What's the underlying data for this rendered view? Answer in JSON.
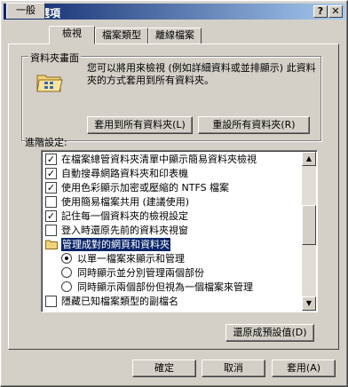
{
  "window": {
    "title": "資料夾選項"
  },
  "title_buttons": {
    "help": "?",
    "close": "✕"
  },
  "tabs": [
    {
      "label": "一般"
    },
    {
      "label": "檢視"
    },
    {
      "label": "檔案類型"
    },
    {
      "label": "離線檔案"
    }
  ],
  "folder_view": {
    "group_label": "資料夾畫面",
    "description": "您可以將用來檢視 (例如詳細資料或並排顯示) 此資料夾的方式套用到所有資料夾。",
    "apply_all_button": "套用到所有資料夾(L)",
    "reset_all_button": "重設所有資料夾(R)"
  },
  "advanced": {
    "label": "進階設定:",
    "items": [
      {
        "kind": "checkbox",
        "checked": true,
        "label": "在檔案總管資料夾清單中顯示簡易資料夾檢視"
      },
      {
        "kind": "checkbox",
        "checked": true,
        "label": "自動搜尋網路資料夾和印表機"
      },
      {
        "kind": "checkbox",
        "checked": true,
        "label": "使用色彩顯示加密或壓縮的 NTFS 檔案"
      },
      {
        "kind": "checkbox",
        "checked": false,
        "label": "使用簡易檔案共用 (建議使用)"
      },
      {
        "kind": "checkbox",
        "checked": true,
        "label": "記住每一個資料夾的檢視設定"
      },
      {
        "kind": "checkbox",
        "checked": false,
        "label": "登入時還原先前的資料夾視窗"
      },
      {
        "kind": "folder",
        "label": "管理成對的網頁和資料夾"
      },
      {
        "kind": "radio",
        "checked": true,
        "label": "以單一檔案來顯示和管理"
      },
      {
        "kind": "radio",
        "checked": false,
        "label": "同時顯示並分別管理兩個部份"
      },
      {
        "kind": "radio",
        "checked": false,
        "label": "同時顯示兩個部份但視為一個檔案來管理"
      },
      {
        "kind": "checkbox",
        "checked": false,
        "label": "隱藏已知檔案類型的副檔名"
      }
    ],
    "restore_defaults_button": "還原成預設值(D)"
  },
  "footer": {
    "ok": "確定",
    "cancel": "取消",
    "apply": "套用(A)"
  }
}
